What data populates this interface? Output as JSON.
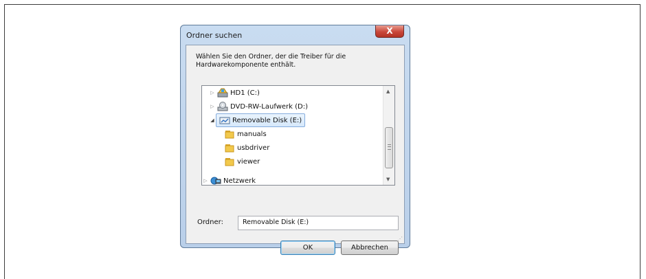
{
  "dialog": {
    "title": "Ordner suchen",
    "close_label": "X",
    "description": "Wählen Sie den Ordner, der die Treiber für die Hardwarekomponente enthält.",
    "tree": [
      {
        "label": "HD1 (C:)",
        "icon": "hard-drive-icon",
        "expander": "▷",
        "level": 1
      },
      {
        "label": "DVD-RW-Laufwerk (D:)",
        "icon": "dvd-drive-icon",
        "expander": "▷",
        "level": 1
      },
      {
        "label": "Removable Disk (E:)",
        "icon": "removable-disk-icon",
        "expander": "◢",
        "level": 1,
        "selected": true
      },
      {
        "label": "manuals",
        "icon": "folder-icon",
        "level": 2
      },
      {
        "label": "usbdriver",
        "icon": "folder-icon",
        "level": 2
      },
      {
        "label": "viewer",
        "icon": "folder-icon",
        "level": 2
      },
      {
        "label": "Netzwerk",
        "icon": "network-icon",
        "expander": "▷",
        "level": 0
      }
    ],
    "folder_label": "Ordner:",
    "folder_value": "Removable Disk (E:)",
    "ok_label": "OK",
    "cancel_label": "Abbrechen"
  }
}
